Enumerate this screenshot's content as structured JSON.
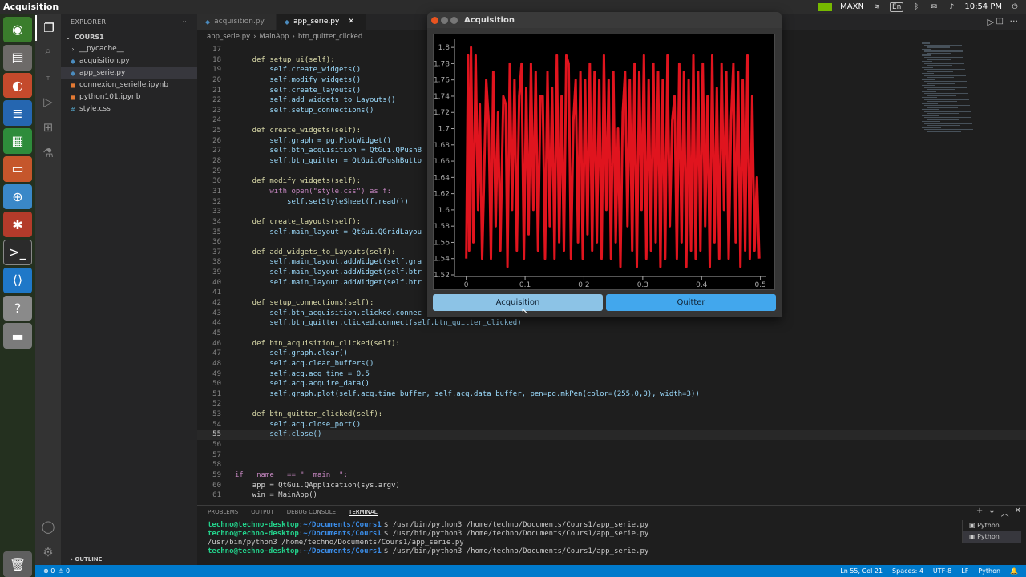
{
  "topbar": {
    "app_name": "Acquisition",
    "network": "MAXN",
    "lang": "En",
    "time": "10:54 PM"
  },
  "editor": {
    "tabs": [
      {
        "label": "acquisition.py",
        "active": false
      },
      {
        "label": "app_serie.py",
        "active": true
      }
    ],
    "breadcrumb": [
      "app_serie.py",
      "MainApp",
      "btn_quitter_clicked"
    ],
    "current_line": 55,
    "lines": [
      {
        "n": "17",
        "t": ""
      },
      {
        "n": "18",
        "t": "    def setup_ui(self):"
      },
      {
        "n": "19",
        "t": "        self.create_widgets()"
      },
      {
        "n": "20",
        "t": "        self.modify_widgets()"
      },
      {
        "n": "21",
        "t": "        self.create_layouts()"
      },
      {
        "n": "22",
        "t": "        self.add_widgets_to_Layouts()"
      },
      {
        "n": "23",
        "t": "        self.setup_connections()"
      },
      {
        "n": "24",
        "t": ""
      },
      {
        "n": "25",
        "t": "    def create_widgets(self):"
      },
      {
        "n": "26",
        "t": "        self.graph = pg.PlotWidget()"
      },
      {
        "n": "27",
        "t": "        self.btn_acquisition = QtGui.QPushB"
      },
      {
        "n": "28",
        "t": "        self.btn_quitter = QtGui.QPushButto"
      },
      {
        "n": "29",
        "t": ""
      },
      {
        "n": "30",
        "t": "    def modify_widgets(self):"
      },
      {
        "n": "31",
        "t": "        with open(\"style.css\") as f:"
      },
      {
        "n": "32",
        "t": "            self.setStyleSheet(f.read())"
      },
      {
        "n": "33",
        "t": ""
      },
      {
        "n": "34",
        "t": "    def create_layouts(self):"
      },
      {
        "n": "35",
        "t": "        self.main_layout = QtGui.QGridLayou"
      },
      {
        "n": "36",
        "t": ""
      },
      {
        "n": "37",
        "t": "    def add_widgets_to_Layouts(self):"
      },
      {
        "n": "38",
        "t": "        self.main_layout.addWidget(self.gra"
      },
      {
        "n": "39",
        "t": "        self.main_layout.addWidget(self.btr"
      },
      {
        "n": "40",
        "t": "        self.main_layout.addWidget(self.btr"
      },
      {
        "n": "41",
        "t": ""
      },
      {
        "n": "42",
        "t": "    def setup_connections(self):"
      },
      {
        "n": "43",
        "t": "        self.btn_acquisition.clicked.connec"
      },
      {
        "n": "44",
        "t": "        self.btn_quitter.clicked.connect(self.btn_quitter_clicked)"
      },
      {
        "n": "45",
        "t": ""
      },
      {
        "n": "46",
        "t": "    def btn_acquisition_clicked(self):"
      },
      {
        "n": "47",
        "t": "        self.graph.clear()"
      },
      {
        "n": "48",
        "t": "        self.acq.clear_buffers()"
      },
      {
        "n": "49",
        "t": "        self.acq.acq_time = 0.5"
      },
      {
        "n": "50",
        "t": "        self.acq.acquire_data()"
      },
      {
        "n": "51",
        "t": "        self.graph.plot(self.acq.time_buffer, self.acq.data_buffer, pen=pg.mkPen(color=(255,0,0), width=3))"
      },
      {
        "n": "52",
        "t": ""
      },
      {
        "n": "53",
        "t": "    def btn_quitter_clicked(self):"
      },
      {
        "n": "54",
        "t": "        self.acq.close_port()"
      },
      {
        "n": "55",
        "t": "        self.close()"
      },
      {
        "n": "56",
        "t": ""
      },
      {
        "n": "57",
        "t": ""
      },
      {
        "n": "58",
        "t": ""
      },
      {
        "n": "59",
        "t": "if __name__ == \"__main__\":"
      },
      {
        "n": "60",
        "t": "    app = QtGui.QApplication(sys.argv)"
      },
      {
        "n": "61",
        "t": "    win = MainApp()"
      }
    ]
  },
  "sidebar": {
    "header": "EXPLORER",
    "folder": "COURS1",
    "items": [
      {
        "label": "__pycache__",
        "kind": "folder",
        "selected": false
      },
      {
        "label": "acquisition.py",
        "kind": "py",
        "selected": false
      },
      {
        "label": "app_serie.py",
        "kind": "py",
        "selected": true
      },
      {
        "label": "connexion_serielle.ipynb",
        "kind": "nb",
        "selected": false
      },
      {
        "label": "python101.ipynb",
        "kind": "nb",
        "selected": false
      },
      {
        "label": "style.css",
        "kind": "css",
        "selected": false
      }
    ],
    "outline": "OUTLINE"
  },
  "panel": {
    "tabs": [
      "PROBLEMS",
      "OUTPUT",
      "DEBUG CONSOLE",
      "TERMINAL"
    ],
    "active_tab": "TERMINAL",
    "terminal_lines": [
      {
        "user": "techno@techno-desktop",
        "path": "~/Documents/Cours1",
        "cmd": "$ /usr/bin/python3 /home/techno/Documents/Cours1/app_serie.py"
      },
      {
        "user": "techno@techno-desktop",
        "path": "~/Documents/Cours1",
        "cmd": "$ /usr/bin/python3 /home/techno/Documents/Cours1/app_serie.py"
      },
      {
        "user": "",
        "path": "",
        "cmd": "/usr/bin/python3 /home/techno/Documents/Cours1/app_serie.py"
      },
      {
        "user": "techno@techno-desktop",
        "path": "~/Documents/Cours1",
        "cmd": "$ /usr/bin/python3 /home/techno/Documents/Cours1/app_serie.py"
      }
    ],
    "terminal_instances": [
      "Python",
      "Python"
    ]
  },
  "statusbar": {
    "left": [
      "⊗ 0",
      "⚠ 0"
    ],
    "right": [
      "Ln 55, Col 21",
      "Spaces: 4",
      "UTF-8",
      "LF",
      "Python"
    ]
  },
  "acq_window": {
    "title": "Acquisition",
    "btn_acquisition": "Acquisition",
    "btn_quitter": "Quitter"
  },
  "chart_data": {
    "type": "line",
    "title": "",
    "xlabel": "",
    "ylabel": "",
    "xlim": [
      -0.02,
      0.51
    ],
    "ylim": [
      1.52,
      1.81
    ],
    "x_ticks": [
      "0",
      "0.1",
      "0.2",
      "0.3",
      "0.4",
      "0.5"
    ],
    "y_ticks": [
      "1.52",
      "1.54",
      "1.56",
      "1.58",
      "1.6",
      "1.62",
      "1.64",
      "1.66",
      "1.68",
      "1.7",
      "1.72",
      "1.74",
      "1.76",
      "1.78",
      "1.8"
    ],
    "series_color": "#e0141e",
    "series": [
      {
        "x": [
          0,
          0.003,
          0.005,
          0.008,
          0.012,
          0.016,
          0.02,
          0.023,
          0.027,
          0.03,
          0.034,
          0.038,
          0.042,
          0.046,
          0.05,
          0.054,
          0.058,
          0.063,
          0.067,
          0.07,
          0.074,
          0.078,
          0.082,
          0.086,
          0.09,
          0.094,
          0.098,
          0.102,
          0.106,
          0.11,
          0.114,
          0.118,
          0.122,
          0.126,
          0.13,
          0.134,
          0.138,
          0.142,
          0.146,
          0.15,
          0.154,
          0.158,
          0.162,
          0.166,
          0.17,
          0.174,
          0.178,
          0.182,
          0.186,
          0.19,
          0.194,
          0.198,
          0.202,
          0.206,
          0.21,
          0.214,
          0.218,
          0.222,
          0.226,
          0.23,
          0.234,
          0.238,
          0.242,
          0.246,
          0.25,
          0.254,
          0.258,
          0.262,
          0.266,
          0.27,
          0.274,
          0.278,
          0.282,
          0.286,
          0.29,
          0.294,
          0.298,
          0.302,
          0.306,
          0.31,
          0.314,
          0.318,
          0.322,
          0.326,
          0.33,
          0.334,
          0.338,
          0.342,
          0.346,
          0.35,
          0.354,
          0.358,
          0.362,
          0.366,
          0.37,
          0.374,
          0.378,
          0.382,
          0.386,
          0.39,
          0.394,
          0.398,
          0.402,
          0.406,
          0.41,
          0.414,
          0.418,
          0.422,
          0.426,
          0.43,
          0.434,
          0.438,
          0.442,
          0.446,
          0.45,
          0.454,
          0.458,
          0.462,
          0.466,
          0.47,
          0.474,
          0.478,
          0.482,
          0.486,
          0.49,
          0.494,
          0.498
        ],
        "y": [
          1.54,
          1.79,
          1.55,
          1.8,
          1.56,
          1.79,
          1.6,
          1.73,
          1.54,
          1.63,
          1.76,
          1.71,
          1.54,
          1.77,
          1.58,
          1.72,
          1.55,
          1.74,
          1.73,
          1.53,
          1.78,
          1.6,
          1.76,
          1.55,
          1.74,
          1.78,
          1.54,
          1.75,
          1.57,
          1.78,
          1.6,
          1.77,
          1.55,
          1.74,
          1.74,
          1.54,
          1.77,
          1.58,
          1.75,
          1.54,
          1.79,
          1.56,
          1.74,
          1.55,
          1.79,
          1.78,
          1.54,
          1.71,
          1.76,
          1.56,
          1.77,
          1.54,
          1.76,
          1.57,
          1.78,
          1.55,
          1.77,
          1.56,
          1.76,
          1.54,
          1.79,
          1.6,
          1.76,
          1.54,
          1.77,
          1.56,
          1.7,
          1.53,
          1.72,
          1.77,
          1.58,
          1.76,
          1.55,
          1.78,
          1.53,
          1.77,
          1.6,
          1.79,
          1.54,
          1.76,
          1.55,
          1.78,
          1.56,
          1.77,
          1.53,
          1.76,
          1.54,
          1.79,
          1.58,
          1.71,
          1.74,
          1.54,
          1.78,
          1.56,
          1.77,
          1.53,
          1.76,
          1.55,
          1.79,
          1.54,
          1.77,
          1.55,
          1.78,
          1.58,
          1.74,
          1.53,
          1.79,
          1.56,
          1.75,
          1.54,
          1.78,
          1.6,
          1.77,
          1.54,
          1.71,
          1.78,
          1.56,
          1.77,
          1.53,
          1.76,
          1.55,
          1.79,
          1.54,
          1.74,
          1.55,
          1.64,
          1.54
        ]
      }
    ],
    "grid": false
  }
}
